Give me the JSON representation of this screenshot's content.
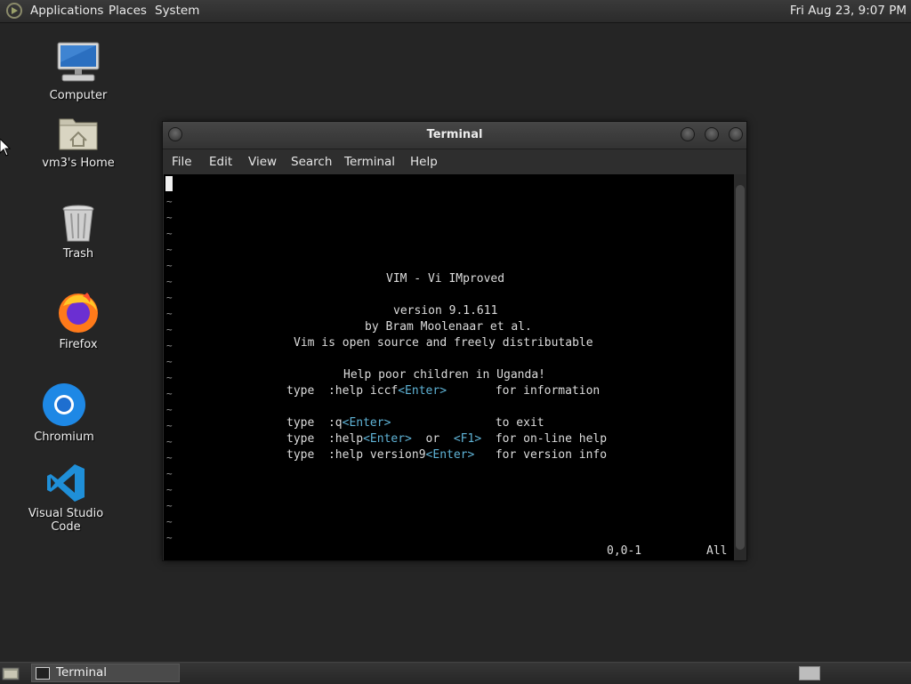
{
  "top_panel": {
    "menus": [
      "Applications",
      "Places",
      "System"
    ],
    "clock": "Fri Aug 23,  9:07 PM"
  },
  "desktop": {
    "icons": [
      {
        "label": "Computer",
        "icon": "computer-icon"
      },
      {
        "label": "vm3's Home",
        "icon": "home-folder-icon"
      },
      {
        "label": "Trash",
        "icon": "trash-icon"
      },
      {
        "label": "Firefox",
        "icon": "firefox-icon"
      },
      {
        "label": "Chromium",
        "icon": "chromium-icon"
      },
      {
        "label": "Visual Studio Code",
        "icon": "vscode-icon"
      }
    ]
  },
  "terminal": {
    "title": "Terminal",
    "menu": [
      "File",
      "Edit",
      "View",
      "Search",
      "Terminal",
      "Help"
    ],
    "vim": {
      "title_line": "VIM - Vi IMproved",
      "version": "version 9.1.611",
      "author": "by Bram Moolenaar et al.",
      "license": "Vim is open source and freely distributable",
      "charity": "Help poor children in Uganda!",
      "help_lines": [
        {
          "prefix": "type  :help iccf",
          "key": "<Enter>",
          "gap": "       ",
          "suffix": "for information"
        },
        {
          "prefix": "type  :q",
          "key": "<Enter>",
          "gap": "               ",
          "suffix": "to exit"
        },
        {
          "prefix": "type  :help",
          "key": "<Enter>",
          "mid": "  or  ",
          "key2": "<F1>",
          "gap": "  ",
          "suffix": "for on-line help"
        },
        {
          "prefix": "type  :help version9",
          "key": "<Enter>",
          "gap": "   ",
          "suffix": "for version info"
        }
      ],
      "position": "0,0-1",
      "scroll": "All",
      "tilde": "~"
    },
    "colors": {
      "key_highlight": "#5fb3d6",
      "background": "#000000"
    }
  },
  "taskbar": {
    "window_button": "Terminal"
  }
}
